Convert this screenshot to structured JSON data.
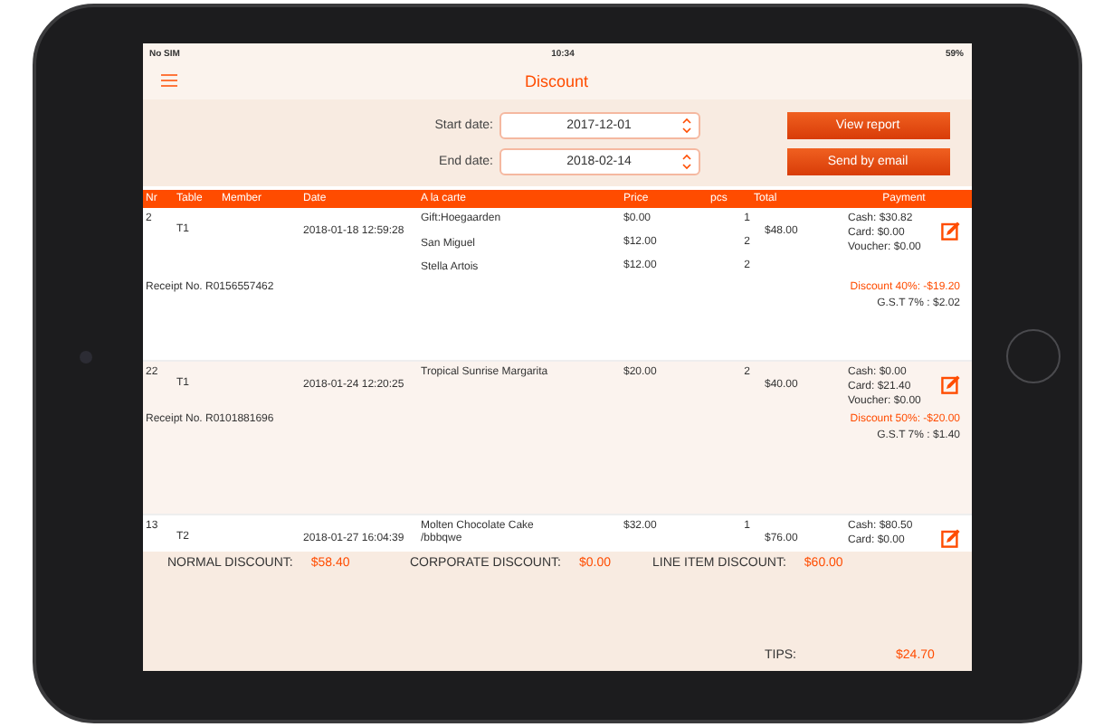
{
  "status_bar": {
    "carrier": "No SIM",
    "time": "10:34",
    "battery": "59%"
  },
  "header": {
    "title": "Discount"
  },
  "filters": [
    {
      "label": "Start date:",
      "value": "2017-12-01"
    },
    {
      "label": "End date:",
      "value": "2018-02-14"
    }
  ],
  "buttons": [
    "View report",
    "Send by email"
  ],
  "table": {
    "columns": [
      "Nr",
      "Table",
      "Member",
      "Date",
      "A la carte",
      "Price",
      "pcs",
      "Total",
      "Payment"
    ],
    "rows": [
      {
        "nr": "2",
        "table": "T1",
        "date": "2018-01-18 12:59:28",
        "items": [
          {
            "name": "Gift:Hoegaarden",
            "price": "$0.00",
            "pcs": "1"
          },
          {
            "name": "San Miguel",
            "price": "$12.00",
            "pcs": "2"
          },
          {
            "name": "Stella Artois",
            "price": "$12.00",
            "pcs": "2"
          }
        ],
        "total": "$48.00",
        "payments": [
          "Cash: $30.82",
          "Card: $0.00",
          "Voucher: $0.00"
        ],
        "receipt": "Receipt No. R0156557462",
        "discount": "Discount 40%: -$19.20",
        "gst": "G.S.T 7% : $2.02"
      },
      {
        "nr": "22",
        "table": "T1",
        "date": "2018-01-24 12:20:25",
        "items": [
          {
            "name": "Tropical Sunrise Margarita",
            "price": "$20.00",
            "pcs": "2"
          }
        ],
        "total": "$40.00",
        "payments": [
          "Cash: $0.00",
          "Card: $21.40",
          "Voucher: $0.00"
        ],
        "receipt": "Receipt No. R0101881696",
        "discount": "Discount 50%: -$20.00",
        "gst": "G.S.T 7% : $1.40"
      },
      {
        "nr": "13",
        "table": "T2",
        "date": "2018-01-27 16:04:39",
        "items": [
          {
            "name": "Molten Chocolate Cake /bbbqwe",
            "price": "$32.00",
            "pcs": "1"
          }
        ],
        "total": "$76.00",
        "payments": [
          "Cash: $80.50",
          "Card: $0.00"
        ]
      }
    ]
  },
  "summary": [
    {
      "label": "NORMAL DISCOUNT:",
      "value": "$58.40"
    },
    {
      "label": "CORPORATE DISCOUNT:",
      "value": "$0.00"
    },
    {
      "label": "LINE ITEM DISCOUNT:",
      "value": "$60.00"
    }
  ],
  "tips": {
    "label": "TIPS:",
    "value": "$24.70"
  }
}
